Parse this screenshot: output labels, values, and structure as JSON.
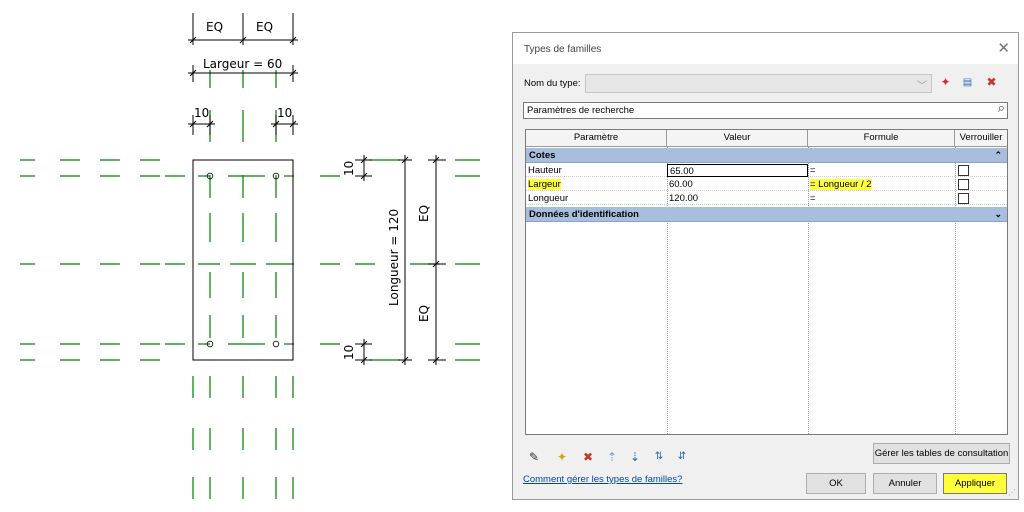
{
  "drawing": {
    "dims": {
      "eq": "EQ",
      "largeur": "Largeur = 60",
      "offset10": "10",
      "longueur": "Longueur = 120"
    }
  },
  "dialog": {
    "title": "Types de familles",
    "close_icon": "close-icon",
    "type_label": "Nom du type:",
    "type_value": "",
    "search_placeholder": "Paramètres de recherche",
    "columns": [
      "Paramètre",
      "Valeur",
      "Formule",
      "Verrouiller"
    ],
    "groups": [
      {
        "name": "Cotes",
        "expanded": true,
        "rows": [
          {
            "param": "Hauteur",
            "value": "65.00",
            "formula": "=",
            "locked": false
          },
          {
            "param": "Largeur",
            "value": "60.00",
            "formula": "= Longueur / 2",
            "locked": false
          },
          {
            "param": "Longueur",
            "value": "120.00",
            "formula": "=",
            "locked": false
          }
        ]
      },
      {
        "name": "Données d'identification",
        "expanded": false,
        "rows": []
      }
    ],
    "lookup_button": "Gérer les tables de consultation",
    "help_link": "Comment gérer les types de familles?",
    "ok": "OK",
    "cancel": "Annuler",
    "apply": "Appliquer",
    "colors": {
      "highlight": "#ffff3c",
      "group_header": "#a8bedd",
      "dimension_green": "#008000",
      "link": "#0645ad"
    }
  }
}
